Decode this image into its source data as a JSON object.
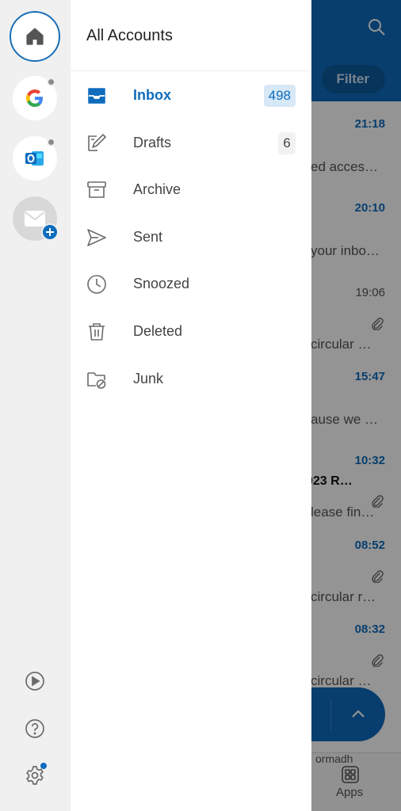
{
  "background": {
    "filter_label": "Filter",
    "messages": [
      {
        "time": "21:18",
        "unread": true,
        "subject": "",
        "preview": "ed acces…",
        "attachment": false
      },
      {
        "time": "20:10",
        "unread": true,
        "subject": "",
        "preview": "your inbo…",
        "attachment": false
      },
      {
        "time": "19:06",
        "unread": false,
        "subject": "",
        "preview": "circular …",
        "attachment": true
      },
      {
        "time": "15:47",
        "unread": true,
        "subject": "",
        "preview": "ause we …",
        "attachment": false
      },
      {
        "time": "10:32",
        "unread": true,
        "subject": "023 R…",
        "preview": "lease fin…",
        "attachment": true
      },
      {
        "time": "08:52",
        "unread": true,
        "subject": "",
        "preview": "circular r…",
        "attachment": true
      },
      {
        "time": "08:32",
        "unread": true,
        "subject": "",
        "preview": "circular …",
        "attachment": true
      }
    ],
    "bottom_text": "ormadh",
    "apps_label": "Apps"
  },
  "rail": {
    "accounts": [
      {
        "name": "home-account",
        "icon": "home-icon"
      },
      {
        "name": "google-account",
        "icon": "google-logo-icon",
        "status_dot": true
      },
      {
        "name": "outlook-account",
        "icon": "outlook-logo-icon",
        "status_dot": true
      },
      {
        "name": "add-account",
        "icon": "mail-plus-icon"
      }
    ],
    "bottom_buttons": [
      "play-icon",
      "help-icon",
      "settings-icon"
    ],
    "settings_badge_color": "#0f6cbd"
  },
  "drawer": {
    "title": "All Accounts",
    "folders": [
      {
        "label": "Inbox",
        "count": "498",
        "active": true,
        "icon": "inbox-icon"
      },
      {
        "label": "Drafts",
        "count": "6",
        "active": false,
        "icon": "drafts-icon"
      },
      {
        "label": "Archive",
        "count": "",
        "active": false,
        "icon": "archive-icon"
      },
      {
        "label": "Sent",
        "count": "",
        "active": false,
        "icon": "sent-icon"
      },
      {
        "label": "Snoozed",
        "count": "",
        "active": false,
        "icon": "clock-icon"
      },
      {
        "label": "Deleted",
        "count": "",
        "active": false,
        "icon": "trash-icon"
      },
      {
        "label": "Junk",
        "count": "",
        "active": false,
        "icon": "junk-folder-icon"
      }
    ]
  },
  "colors": {
    "accent": "#0f6cbd",
    "badge_active_bg": "#d7e8f7",
    "rail_bg": "#f0f0f0"
  }
}
